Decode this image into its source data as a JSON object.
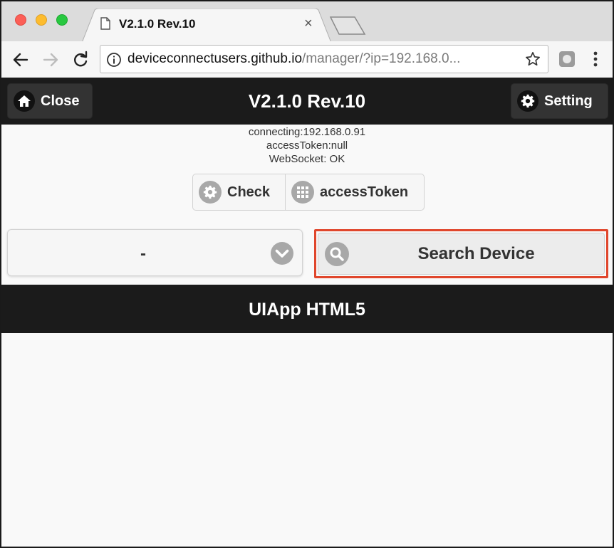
{
  "browser": {
    "tab_title": "V2.1.0 Rev.10",
    "tab_close": "×",
    "url_host": "deviceconnectusers.github.io",
    "url_path": "/manager/?ip=192.168.0..."
  },
  "header": {
    "close_label": "Close",
    "title": "V2.1.0 Rev.10",
    "setting_label": "Setting"
  },
  "status": {
    "connecting": "connecting:192.168.0.91",
    "access_token": "accessToken:null",
    "websocket": "WebSocket: OK"
  },
  "controls": {
    "check_label": "Check",
    "access_token_label": "accessToken"
  },
  "device_select": {
    "selected": "-"
  },
  "search": {
    "label": "Search Device"
  },
  "uiapp": {
    "title": "UIApp HTML5"
  },
  "icons": {
    "close": "home-icon",
    "setting": "gear-icon",
    "check": "gear-icon",
    "access_token": "grid-icon",
    "select": "chevron-down-icon",
    "search": "search-icon"
  },
  "colors": {
    "header_bg": "#1b1b1b",
    "highlight": "#e0462c",
    "icon_gray": "#a8a8a8"
  }
}
